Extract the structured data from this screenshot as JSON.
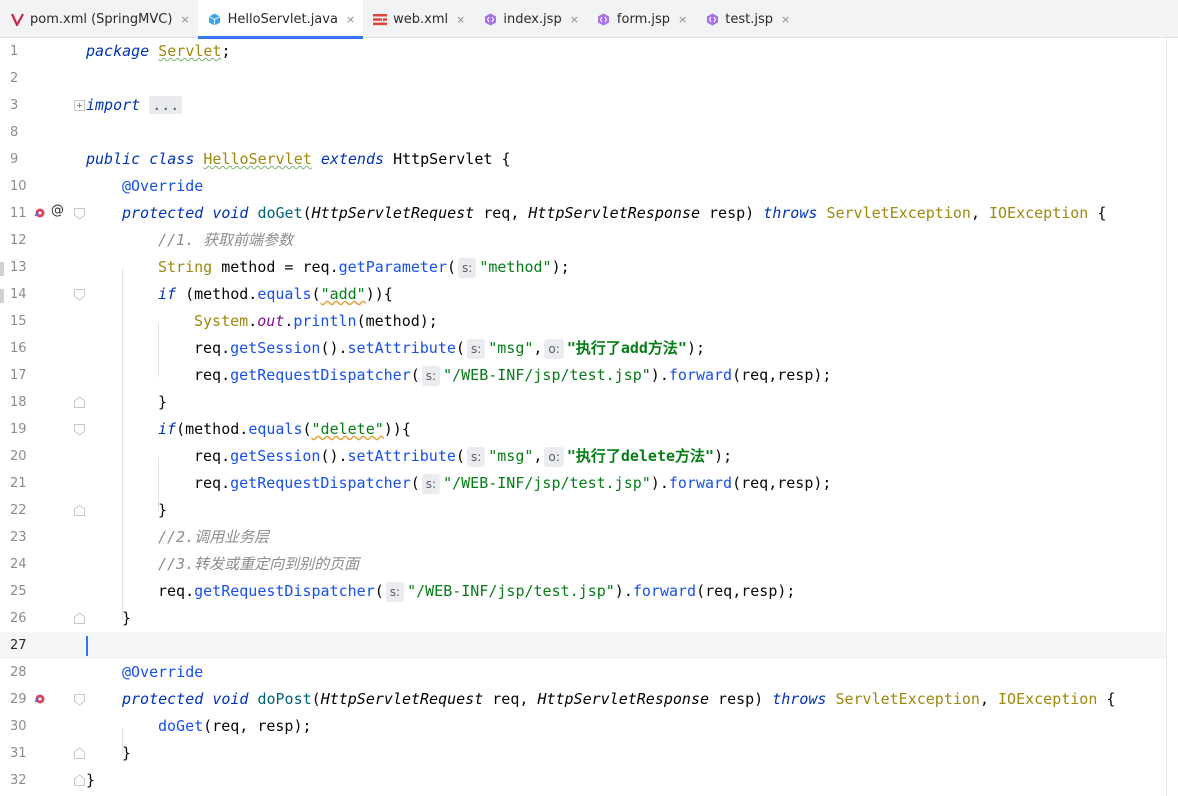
{
  "tabs": [
    {
      "label": "pom.xml (SpringMVC)",
      "icon": "maven-icon",
      "active": false
    },
    {
      "label": "HelloServlet.java",
      "icon": "java-class-icon",
      "active": true
    },
    {
      "label": "web.xml",
      "icon": "xml-icon",
      "active": false
    },
    {
      "label": "index.jsp",
      "icon": "jsp-icon",
      "active": false
    },
    {
      "label": "form.jsp",
      "icon": "jsp-icon",
      "active": false
    },
    {
      "label": "test.jsp",
      "icon": "jsp-icon",
      "active": false
    }
  ],
  "tab_close_glyph": "×",
  "editor": {
    "current_line": "27",
    "lines": [
      {
        "n": "1",
        "t": {
          "a": "package",
          "b": "Servlet",
          "c": ";"
        }
      },
      {
        "n": "2"
      },
      {
        "n": "3",
        "t": {
          "a": "import",
          "b": "..."
        }
      },
      {
        "n": "8"
      },
      {
        "n": "9",
        "t": {
          "a": "public",
          "b": "class",
          "c": "HelloServlet",
          "d": "extends",
          "e": "HttpServlet",
          "f": "{"
        }
      },
      {
        "n": "10",
        "t": {
          "a": "@Override"
        }
      },
      {
        "n": "11",
        "t": {
          "a": "protected",
          "b": "void",
          "c": "doGet",
          "d": "(",
          "e": "HttpServletRequest",
          "f": " req, ",
          "g": "HttpServletResponse",
          "h": " resp) ",
          "i": "throws",
          "j": "ServletException",
          "k": ", ",
          "l": "IOException",
          "m": " {"
        }
      },
      {
        "n": "12",
        "t": {
          "a": "//1. 获取前端参数"
        }
      },
      {
        "n": "13",
        "t": {
          "a": "String",
          "b": " method = req.",
          "c": "getParameter",
          "d": "(",
          "h": "s:",
          "e": "\"method\"",
          "f": ");"
        }
      },
      {
        "n": "14",
        "t": {
          "a": "if",
          "b": " (method.",
          "c": "equals",
          "d": "(",
          "e": "\"add\"",
          "f": ")){"
        }
      },
      {
        "n": "15",
        "t": {
          "a": "System",
          "b": ".",
          "c": "out",
          "d": ".",
          "e": "println",
          "f": "(method);"
        }
      },
      {
        "n": "16",
        "t": {
          "a": "req.",
          "b": "getSession",
          "c": "().",
          "d": "setAttribute",
          "e": "(",
          "h1": "s:",
          "f": "\"msg\"",
          "g": ",",
          "h2": "o:",
          "i": "\"执行了add方法\"",
          "j": ");"
        }
      },
      {
        "n": "17",
        "t": {
          "a": "req.",
          "b": "getRequestDispatcher",
          "c": "(",
          "h": "s:",
          "d": "\"/WEB-INF/jsp/test.jsp\"",
          "e": ").",
          "f": "forward",
          "g": "(req,resp);"
        }
      },
      {
        "n": "18",
        "t": {
          "a": "}"
        }
      },
      {
        "n": "19",
        "t": {
          "a": "if",
          "b": "(method.",
          "c": "equals",
          "d": "(",
          "e": "\"delete\"",
          "f": ")){"
        }
      },
      {
        "n": "20",
        "t": {
          "a": "req.",
          "b": "getSession",
          "c": "().",
          "d": "setAttribute",
          "e": "(",
          "h1": "s:",
          "f": "\"msg\"",
          "g": ",",
          "h2": "o:",
          "i": "\"执行了delete方法\"",
          "j": ");"
        }
      },
      {
        "n": "21",
        "t": {
          "a": "req.",
          "b": "getRequestDispatcher",
          "c": "(",
          "h": "s:",
          "d": "\"/WEB-INF/jsp/test.jsp\"",
          "e": ").",
          "f": "forward",
          "g": "(req,resp);"
        }
      },
      {
        "n": "22",
        "t": {
          "a": "}"
        }
      },
      {
        "n": "23",
        "t": {
          "a": "//2.调用业务层"
        }
      },
      {
        "n": "24",
        "t": {
          "a": "//3.转发或重定向到别的页面"
        }
      },
      {
        "n": "25",
        "t": {
          "a": "req.",
          "b": "getRequestDispatcher",
          "c": "(",
          "h": "s:",
          "d": "\"/WEB-INF/jsp/test.jsp\"",
          "e": ").",
          "f": "forward",
          "g": "(req,resp);"
        }
      },
      {
        "n": "26",
        "t": {
          "a": "}"
        }
      },
      {
        "n": "27"
      },
      {
        "n": "28",
        "t": {
          "a": "@Override"
        }
      },
      {
        "n": "29",
        "t": {
          "a": "protected",
          "b": "void",
          "c": "doPost",
          "d": "(",
          "e": "HttpServletRequest",
          "f": " req, ",
          "g": "HttpServletResponse",
          "h": " resp) ",
          "i": "throws",
          "j": "ServletException",
          "k": ", ",
          "l": "IOException",
          "m": " {"
        }
      },
      {
        "n": "30",
        "t": {
          "a": "doGet",
          "b": "(req, resp);"
        }
      },
      {
        "n": "31",
        "t": {
          "a": "}"
        }
      },
      {
        "n": "32",
        "t": {
          "a": "}"
        }
      }
    ],
    "gutter_markers": {
      "line_11": "@"
    }
  },
  "colors": {
    "keyword": "#0033b3",
    "string": "#067d17",
    "annotation": "#9e880d",
    "comment": "#8c8c8c",
    "method_call": "#1750eb",
    "active_tab_underline": "#3574f0"
  }
}
